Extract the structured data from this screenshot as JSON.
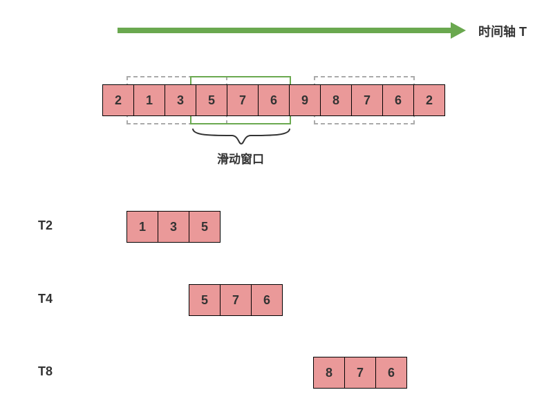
{
  "time_axis_label": "时间轴 T",
  "axis_arrow_color": "#6aa84f",
  "sliding_window_label": "滑动窗口",
  "main_cells": [
    "2",
    "1",
    "3",
    "5",
    "7",
    "6",
    "9",
    "8",
    "7",
    "6",
    "2"
  ],
  "windows": [
    {
      "label": "T2",
      "values": [
        "1",
        "3",
        "5"
      ]
    },
    {
      "label": "T4",
      "values": [
        "5",
        "7",
        "6"
      ]
    },
    {
      "label": "T8",
      "values": [
        "8",
        "7",
        "6"
      ]
    }
  ],
  "cell_color": "#ea9999"
}
